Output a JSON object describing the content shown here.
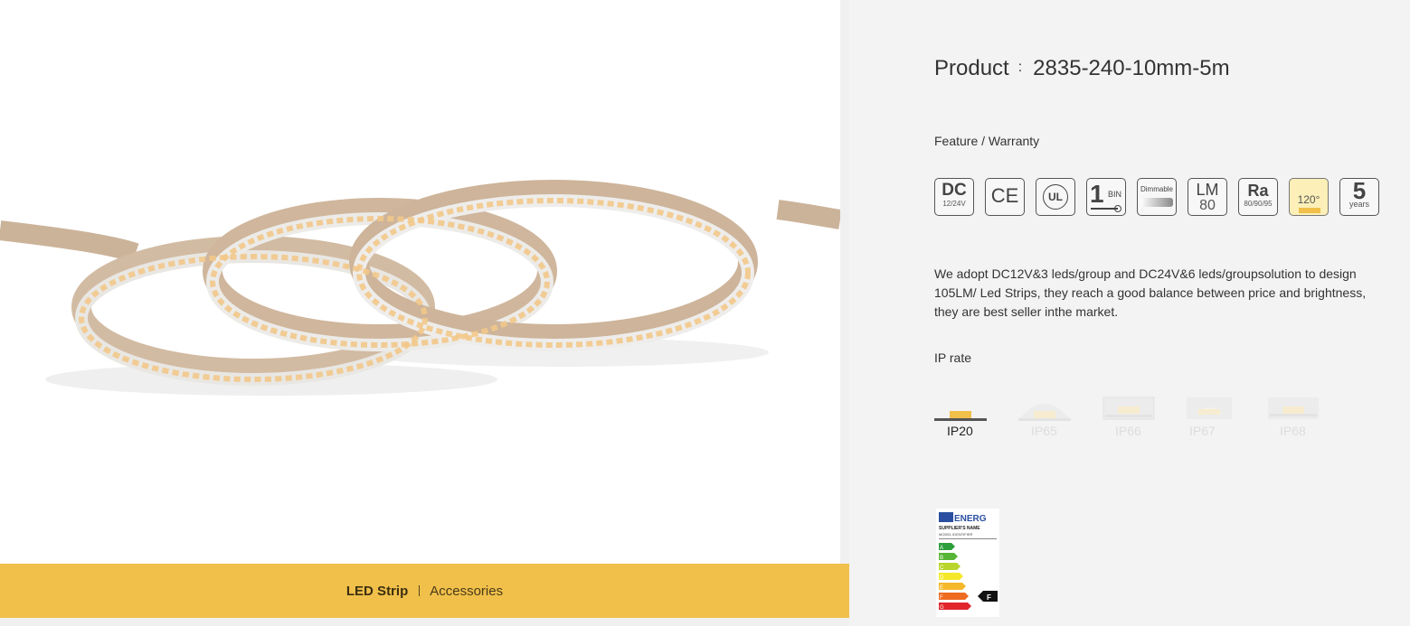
{
  "product": {
    "label": "Product",
    "colon": ":",
    "model": "2835-240-10mm-5m"
  },
  "categories": {
    "active": "LED Strip",
    "other": "Accessories"
  },
  "feature": {
    "heading": "Feature / Warranty",
    "badges": {
      "dc": {
        "main": "DC",
        "sub": "12/24V"
      },
      "ce": {
        "main": "CE"
      },
      "ul": {
        "main": "UL"
      },
      "bin": {
        "main": "1",
        "sub": "BIN"
      },
      "dimmable": {
        "main": "Dimmable"
      },
      "lm": {
        "main": "LM",
        "sub": "80"
      },
      "ra": {
        "main": "Ra",
        "sub": "80/90/95"
      },
      "angle": {
        "main": "120°"
      },
      "warranty": {
        "main": "5",
        "sub": "years"
      }
    }
  },
  "description": "We adopt DC12V&3 leds/group and DC24V&6 leds/groupsolution to design 105LM/ Led Strips, they reach a good balance between price and brightness, they are best seller inthe market.",
  "ip": {
    "heading": "IP rate",
    "options": [
      {
        "label": "IP20",
        "selected": true
      },
      {
        "label": "IP65",
        "selected": false
      },
      {
        "label": "IP66",
        "selected": false
      },
      {
        "label": "IP67",
        "selected": false
      },
      {
        "label": "IP68",
        "selected": false
      }
    ]
  },
  "energy_label": {
    "brand": "ENERG",
    "supplier": "SUPPLIER'S NAME",
    "model": "MODEL IDENTIFIER",
    "classes": [
      "A",
      "B",
      "C",
      "D",
      "E",
      "F",
      "G"
    ],
    "rating": "F"
  },
  "colors": {
    "accent": "#f0c04a",
    "text": "#333333",
    "panel": "#f3f3f3"
  }
}
